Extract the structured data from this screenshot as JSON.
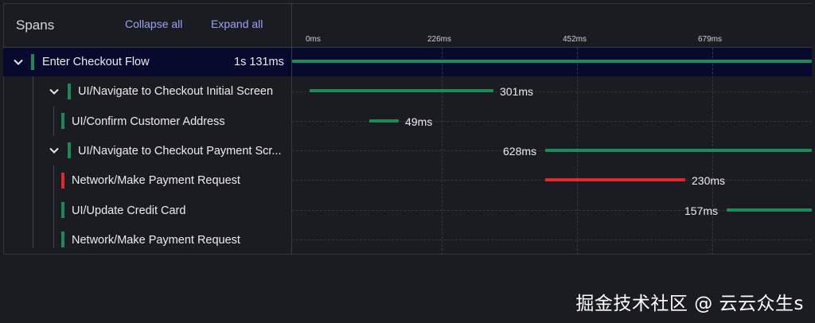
{
  "header": {
    "title": "Spans",
    "collapse_label": "Collapse all",
    "expand_label": "Expand all"
  },
  "timeline": {
    "ticks": [
      "0ms",
      "226ms",
      "452ms",
      "679ms"
    ]
  },
  "spans": [
    {
      "label": "Enter Checkout Flow",
      "duration": "1s 131ms",
      "status": "ok",
      "expanded": true
    },
    {
      "label": "UI/Navigate to Checkout Initial Screen",
      "duration": "301ms",
      "status": "ok",
      "expanded": true
    },
    {
      "label": "UI/Confirm Customer Address",
      "duration": "49ms",
      "status": "ok"
    },
    {
      "label": "UI/Navigate to Checkout Payment Scr...",
      "duration": "628ms",
      "status": "ok",
      "expanded": true
    },
    {
      "label": "Network/Make Payment Request",
      "duration": "230ms",
      "status": "error"
    },
    {
      "label": "UI/Update Credit Card",
      "duration": "157ms",
      "status": "ok"
    },
    {
      "label": "Network/Make Payment Request",
      "duration": "",
      "status": "ok"
    }
  ],
  "colors": {
    "ok": "#1f8a58",
    "error": "#e0282e",
    "accent": "#9aa2f2",
    "selected_row": "#070a2c"
  },
  "icons": {
    "expand": "chevron-down-icon"
  },
  "watermark": "掘金技术社区 @ 云云众生s"
}
